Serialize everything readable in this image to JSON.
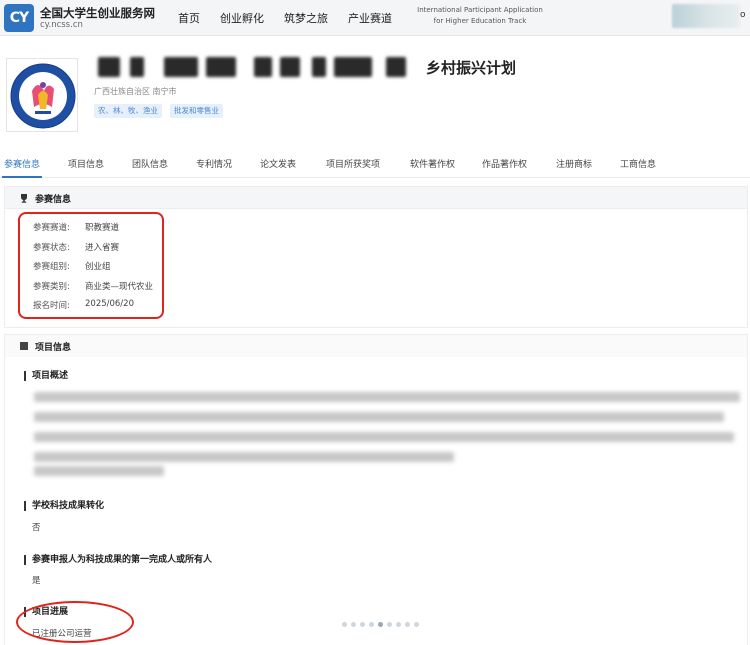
{
  "header": {
    "site_name": "全国大学生创业服务网",
    "site_domain": "cy.ncss.cn",
    "logo_text": "CY",
    "nav": [
      "首页",
      "创业孵化",
      "筑梦之旅",
      "产业赛道"
    ],
    "intl_line1": "International Participant Application",
    "intl_line2": "for Higher Education Track",
    "user_mark": "o"
  },
  "project": {
    "title_visible": "乡村振兴计划",
    "region": "广西壮族自治区   南宁市",
    "tags": [
      "农、林、牧、渔业",
      "批发和零售业"
    ]
  },
  "tabs": [
    "参赛信息",
    "项目信息",
    "团队信息",
    "专利情况",
    "论文发表",
    "项目所获奖项",
    "软件著作权",
    "作品著作权",
    "注册商标",
    "工商信息"
  ],
  "participation": {
    "heading": "参赛信息",
    "fields": [
      {
        "key": "参赛赛道:",
        "value": "职教赛道"
      },
      {
        "key": "参赛状态:",
        "value": "进入省赛"
      },
      {
        "key": "参赛组别:",
        "value": "创业组"
      },
      {
        "key": "参赛类别:",
        "value": "商业类—现代农业"
      },
      {
        "key": "报名时间:",
        "value": "2025/06/20"
      }
    ]
  },
  "project_info": {
    "heading": "项目信息",
    "overview_label": "项目概述",
    "tech_transfer_label": "学校科技成果转化",
    "tech_transfer_value": "否",
    "owner_label": "参赛申报人为科技成果的第一完成人或所有人",
    "owner_value": "是",
    "progress_label": "项目进展",
    "progress_value": "已注册公司运营"
  },
  "colors": {
    "accent": "#2f74c0",
    "annotation_red": "#e0241b",
    "tag_bg": "#e6f0fb"
  },
  "pagination_dots": 9,
  "pagination_active": 4
}
